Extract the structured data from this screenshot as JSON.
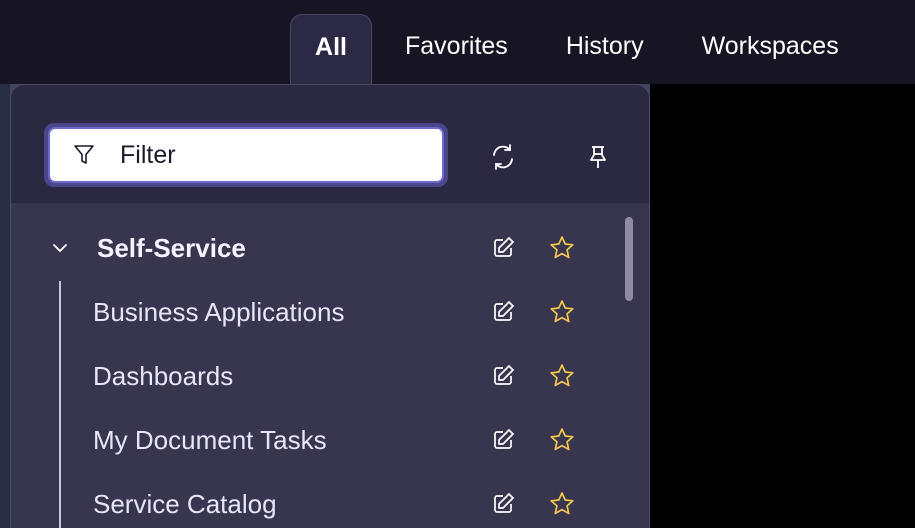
{
  "tabs": [
    {
      "label": "All",
      "active": true
    },
    {
      "label": "Favorites",
      "active": false
    },
    {
      "label": "History",
      "active": false
    },
    {
      "label": "Workspaces",
      "active": false
    }
  ],
  "filter": {
    "placeholder": "Filter",
    "value": ""
  },
  "icons": {
    "filter": "funnel-icon",
    "refresh": "refresh-icon",
    "pin": "pin-icon",
    "expand": "chevron-down-icon",
    "edit": "edit-icon",
    "favorite": "star-icon"
  },
  "colors": {
    "star": "#f3c84b",
    "accent": "#6d6ad0"
  },
  "tree": {
    "root": {
      "label": "Self-Service",
      "expanded": true
    },
    "children": [
      {
        "label": "Business Applications"
      },
      {
        "label": "Dashboards"
      },
      {
        "label": "My Document Tasks"
      },
      {
        "label": "Service Catalog"
      }
    ]
  }
}
